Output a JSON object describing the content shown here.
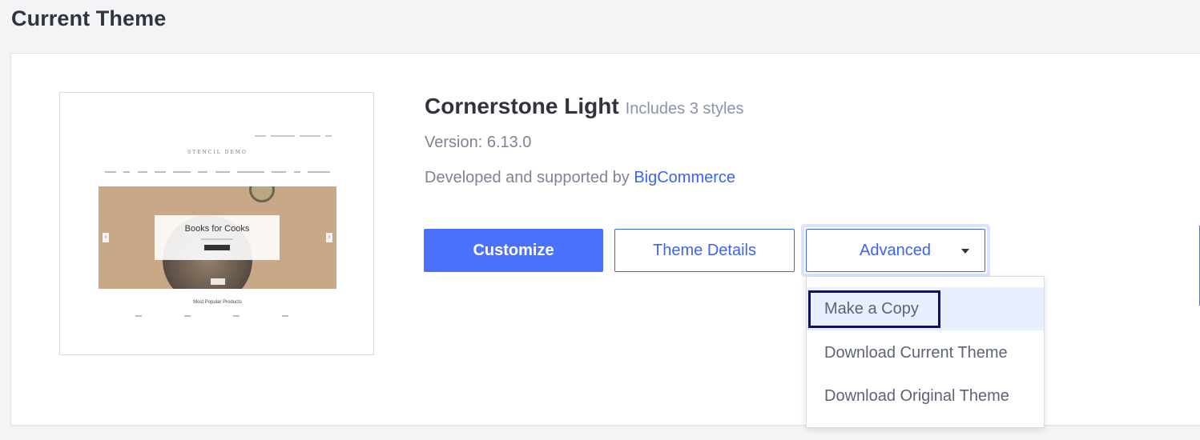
{
  "section": {
    "title": "Current Theme"
  },
  "thumbnail": {
    "logo_text": "STENCIL DEMO",
    "hero_title": "Books for Cooks",
    "popular_label": "Most Popular Products",
    "arrow_left": "‹",
    "arrow_right": "›"
  },
  "theme": {
    "name": "Cornerstone Light",
    "styles_label": "Includes 3 styles",
    "version_label": "Version: 6.13.0",
    "developer_prefix": "Developed and supported by",
    "developer_link": "BigCommerce"
  },
  "actions": {
    "customize_label": "Customize",
    "details_label": "Theme Details",
    "advanced_label": "Advanced"
  },
  "dropdown": {
    "items": [
      {
        "label": "Make a Copy"
      },
      {
        "label": "Download Current Theme"
      },
      {
        "label": "Download Original Theme"
      }
    ]
  },
  "colors": {
    "primary": "#4b71fc",
    "link": "#3c64f4",
    "highlight_border": "#0c0f7a"
  }
}
